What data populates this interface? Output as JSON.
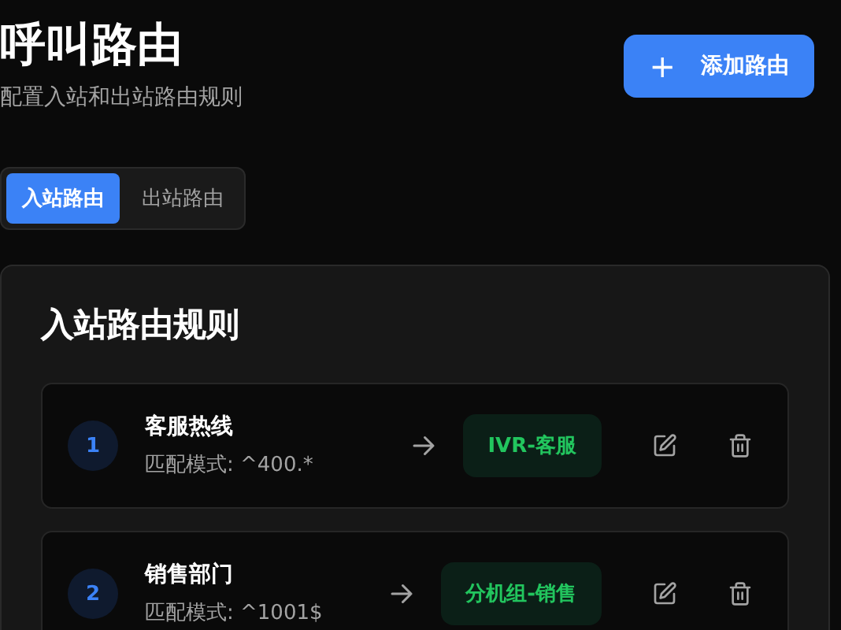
{
  "header": {
    "title": "呼叫路由",
    "subtitle": "配置入站和出站路由规则"
  },
  "add_button": {
    "icon": "+",
    "label": "添加路由"
  },
  "tabs": [
    {
      "label": "入站路由",
      "selected": true
    },
    {
      "label": "出站路由",
      "selected": false
    }
  ],
  "panel": {
    "title": "入站路由规则",
    "routes": [
      {
        "number": "1",
        "name": "客服热线",
        "pattern": "匹配模式: ^400.*",
        "target": "IVR-客服"
      },
      {
        "number": "2",
        "name": "销售部门",
        "pattern": "匹配模式: ^1001$",
        "target": "分机组-销售"
      }
    ]
  }
}
